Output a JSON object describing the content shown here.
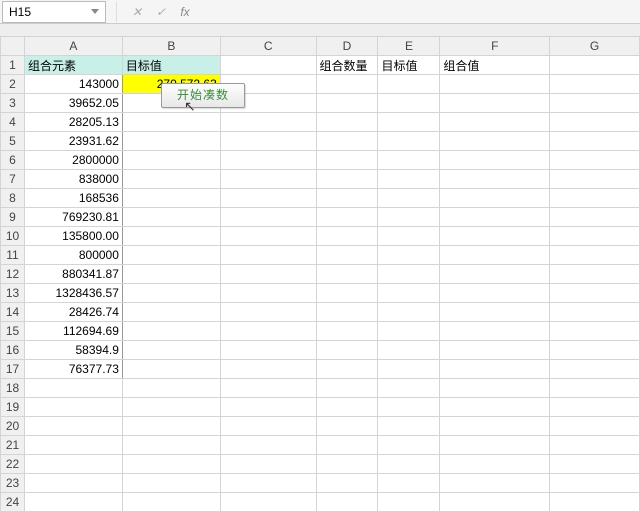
{
  "name_box": "H15",
  "formula_bar_value": "",
  "columns": [
    "A",
    "B",
    "C",
    "D",
    "E",
    "F",
    "G"
  ],
  "row_count": 24,
  "headers_row": {
    "A": "组合元素",
    "B": "目标值",
    "C": "",
    "D": "组合数量",
    "E": "目标值",
    "F": "组合值",
    "G": ""
  },
  "target_value_cell": "270,572.63",
  "button_label": "开始凑数",
  "col_A_values": [
    "143000",
    "39652.05",
    "28205.13",
    "23931.62",
    "2800000",
    "838000",
    "168536",
    "769230.81",
    "135800.00",
    "800000",
    "880341.87",
    "1328436.57",
    "28426.74",
    "112694.69",
    "58394.9",
    "76377.73",
    "",
    "",
    "",
    "",
    "",
    "",
    ""
  ],
  "chart_data": {
    "type": "table",
    "columns": [
      "组合元素",
      "目标值",
      "组合数量",
      "目标值",
      "组合值"
    ],
    "col_A": [
      143000,
      39652.05,
      28205.13,
      23931.62,
      2800000,
      838000,
      168536,
      769230.81,
      135800.0,
      800000,
      880341.87,
      1328436.57,
      28426.74,
      112694.69,
      58394.9,
      76377.73
    ],
    "B2_target": 270572.63
  }
}
